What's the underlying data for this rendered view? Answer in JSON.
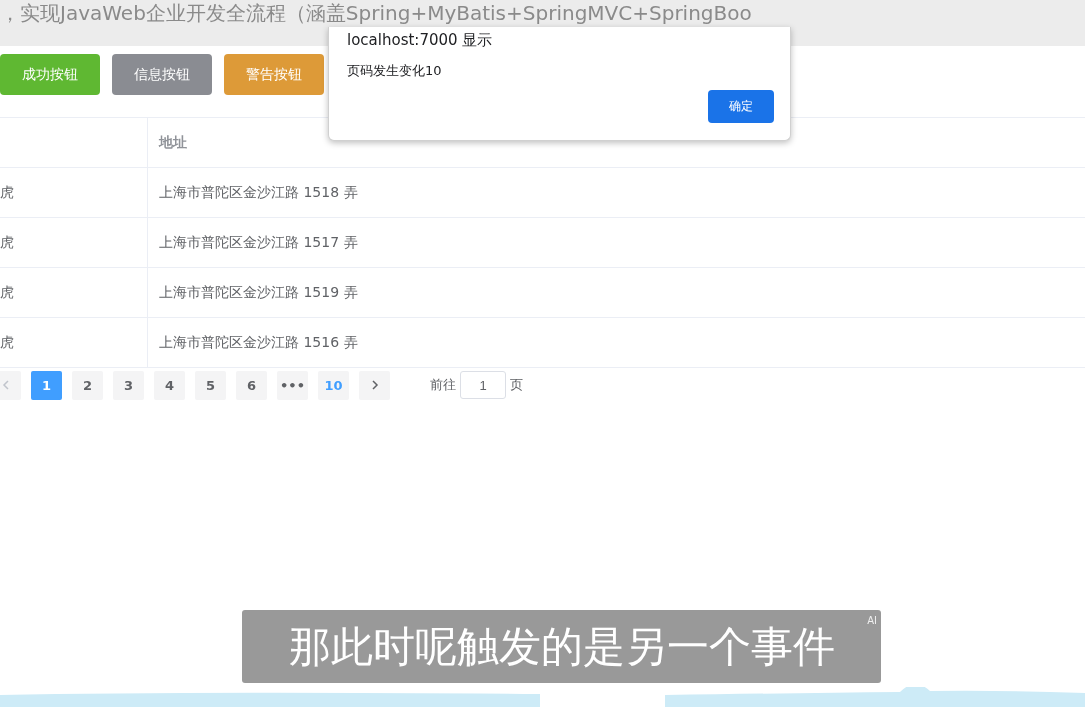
{
  "video_title": "，实现JavaWeb企业开发全流程（涵盖Spring+MyBatis+SpringMVC+SpringBoo",
  "buttons": [
    {
      "label": "成功按钮",
      "kind": "success"
    },
    {
      "label": "信息按钮",
      "kind": "info"
    },
    {
      "label": "警告按钮",
      "kind": "warning"
    }
  ],
  "table": {
    "columns": [
      "",
      "地址"
    ],
    "rows": [
      [
        "虎",
        "上海市普陀区金沙江路 1518 弄"
      ],
      [
        "虎",
        "上海市普陀区金沙江路 1517 弄"
      ],
      [
        "虎",
        "上海市普陀区金沙江路 1519 弄"
      ],
      [
        "虎",
        "上海市普陀区金沙江路 1516 弄"
      ]
    ]
  },
  "pagination": {
    "pages": [
      {
        "label": "1",
        "selected": true,
        "kind": "page"
      },
      {
        "label": "2",
        "selected": false,
        "kind": "page"
      },
      {
        "label": "3",
        "selected": false,
        "kind": "page"
      },
      {
        "label": "4",
        "selected": false,
        "kind": "page"
      },
      {
        "label": "5",
        "selected": false,
        "kind": "page"
      },
      {
        "label": "6",
        "selected": false,
        "kind": "page"
      },
      {
        "label": "•••",
        "selected": false,
        "kind": "more"
      },
      {
        "label": "10",
        "selected": false,
        "kind": "page"
      }
    ],
    "goto_label": "前往",
    "goto_value": "1",
    "goto_suffix": "页"
  },
  "dialog": {
    "title": "localhost:7000 显示",
    "message": "页码发生变化10",
    "ok": "确定"
  },
  "subtitle": "那此时呢触发的是另一个事件",
  "subtitle_badge": "AI"
}
